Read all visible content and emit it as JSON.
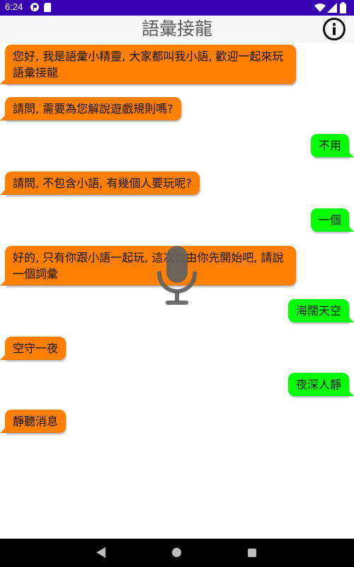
{
  "status_bar": {
    "time": "6:24",
    "icons": [
      "app-icon",
      "sd-card-icon",
      "wifi-icon",
      "signal-icon",
      "battery-icon"
    ]
  },
  "app_bar": {
    "title": "語彙接龍",
    "info_icon": "info-icon"
  },
  "messages": [
    {
      "sender": "bot",
      "text": "您好, 我是語彙小精靈, 大家都叫我小語, 歡迎一起來玩語彙接龍"
    },
    {
      "sender": "bot",
      "text": "請問, 需要為您解說遊戲規則嗎?"
    },
    {
      "sender": "user",
      "text": "不用"
    },
    {
      "sender": "bot",
      "text": "請問, 不包含小語, 有幾個人要玩呢?"
    },
    {
      "sender": "user",
      "text": "一個"
    },
    {
      "sender": "bot",
      "text": "好的, 只有你跟小語一起玩, 這次就由你先開始吧, 請說一個詞彙"
    },
    {
      "sender": "user",
      "text": "海闊天空"
    },
    {
      "sender": "bot",
      "text": "空守一夜"
    },
    {
      "sender": "user",
      "text": "夜深人靜"
    },
    {
      "sender": "bot",
      "text": "靜聽消息"
    }
  ],
  "mic": {
    "icon": "microphone-icon"
  },
  "nav_bar": {
    "icons": [
      "back-icon",
      "home-icon",
      "recents-icon"
    ]
  },
  "colors": {
    "status_bar": "#3700b3",
    "bot_bubble": "#ff7f00",
    "user_bubble": "#00ff00",
    "mic": "#616161"
  }
}
